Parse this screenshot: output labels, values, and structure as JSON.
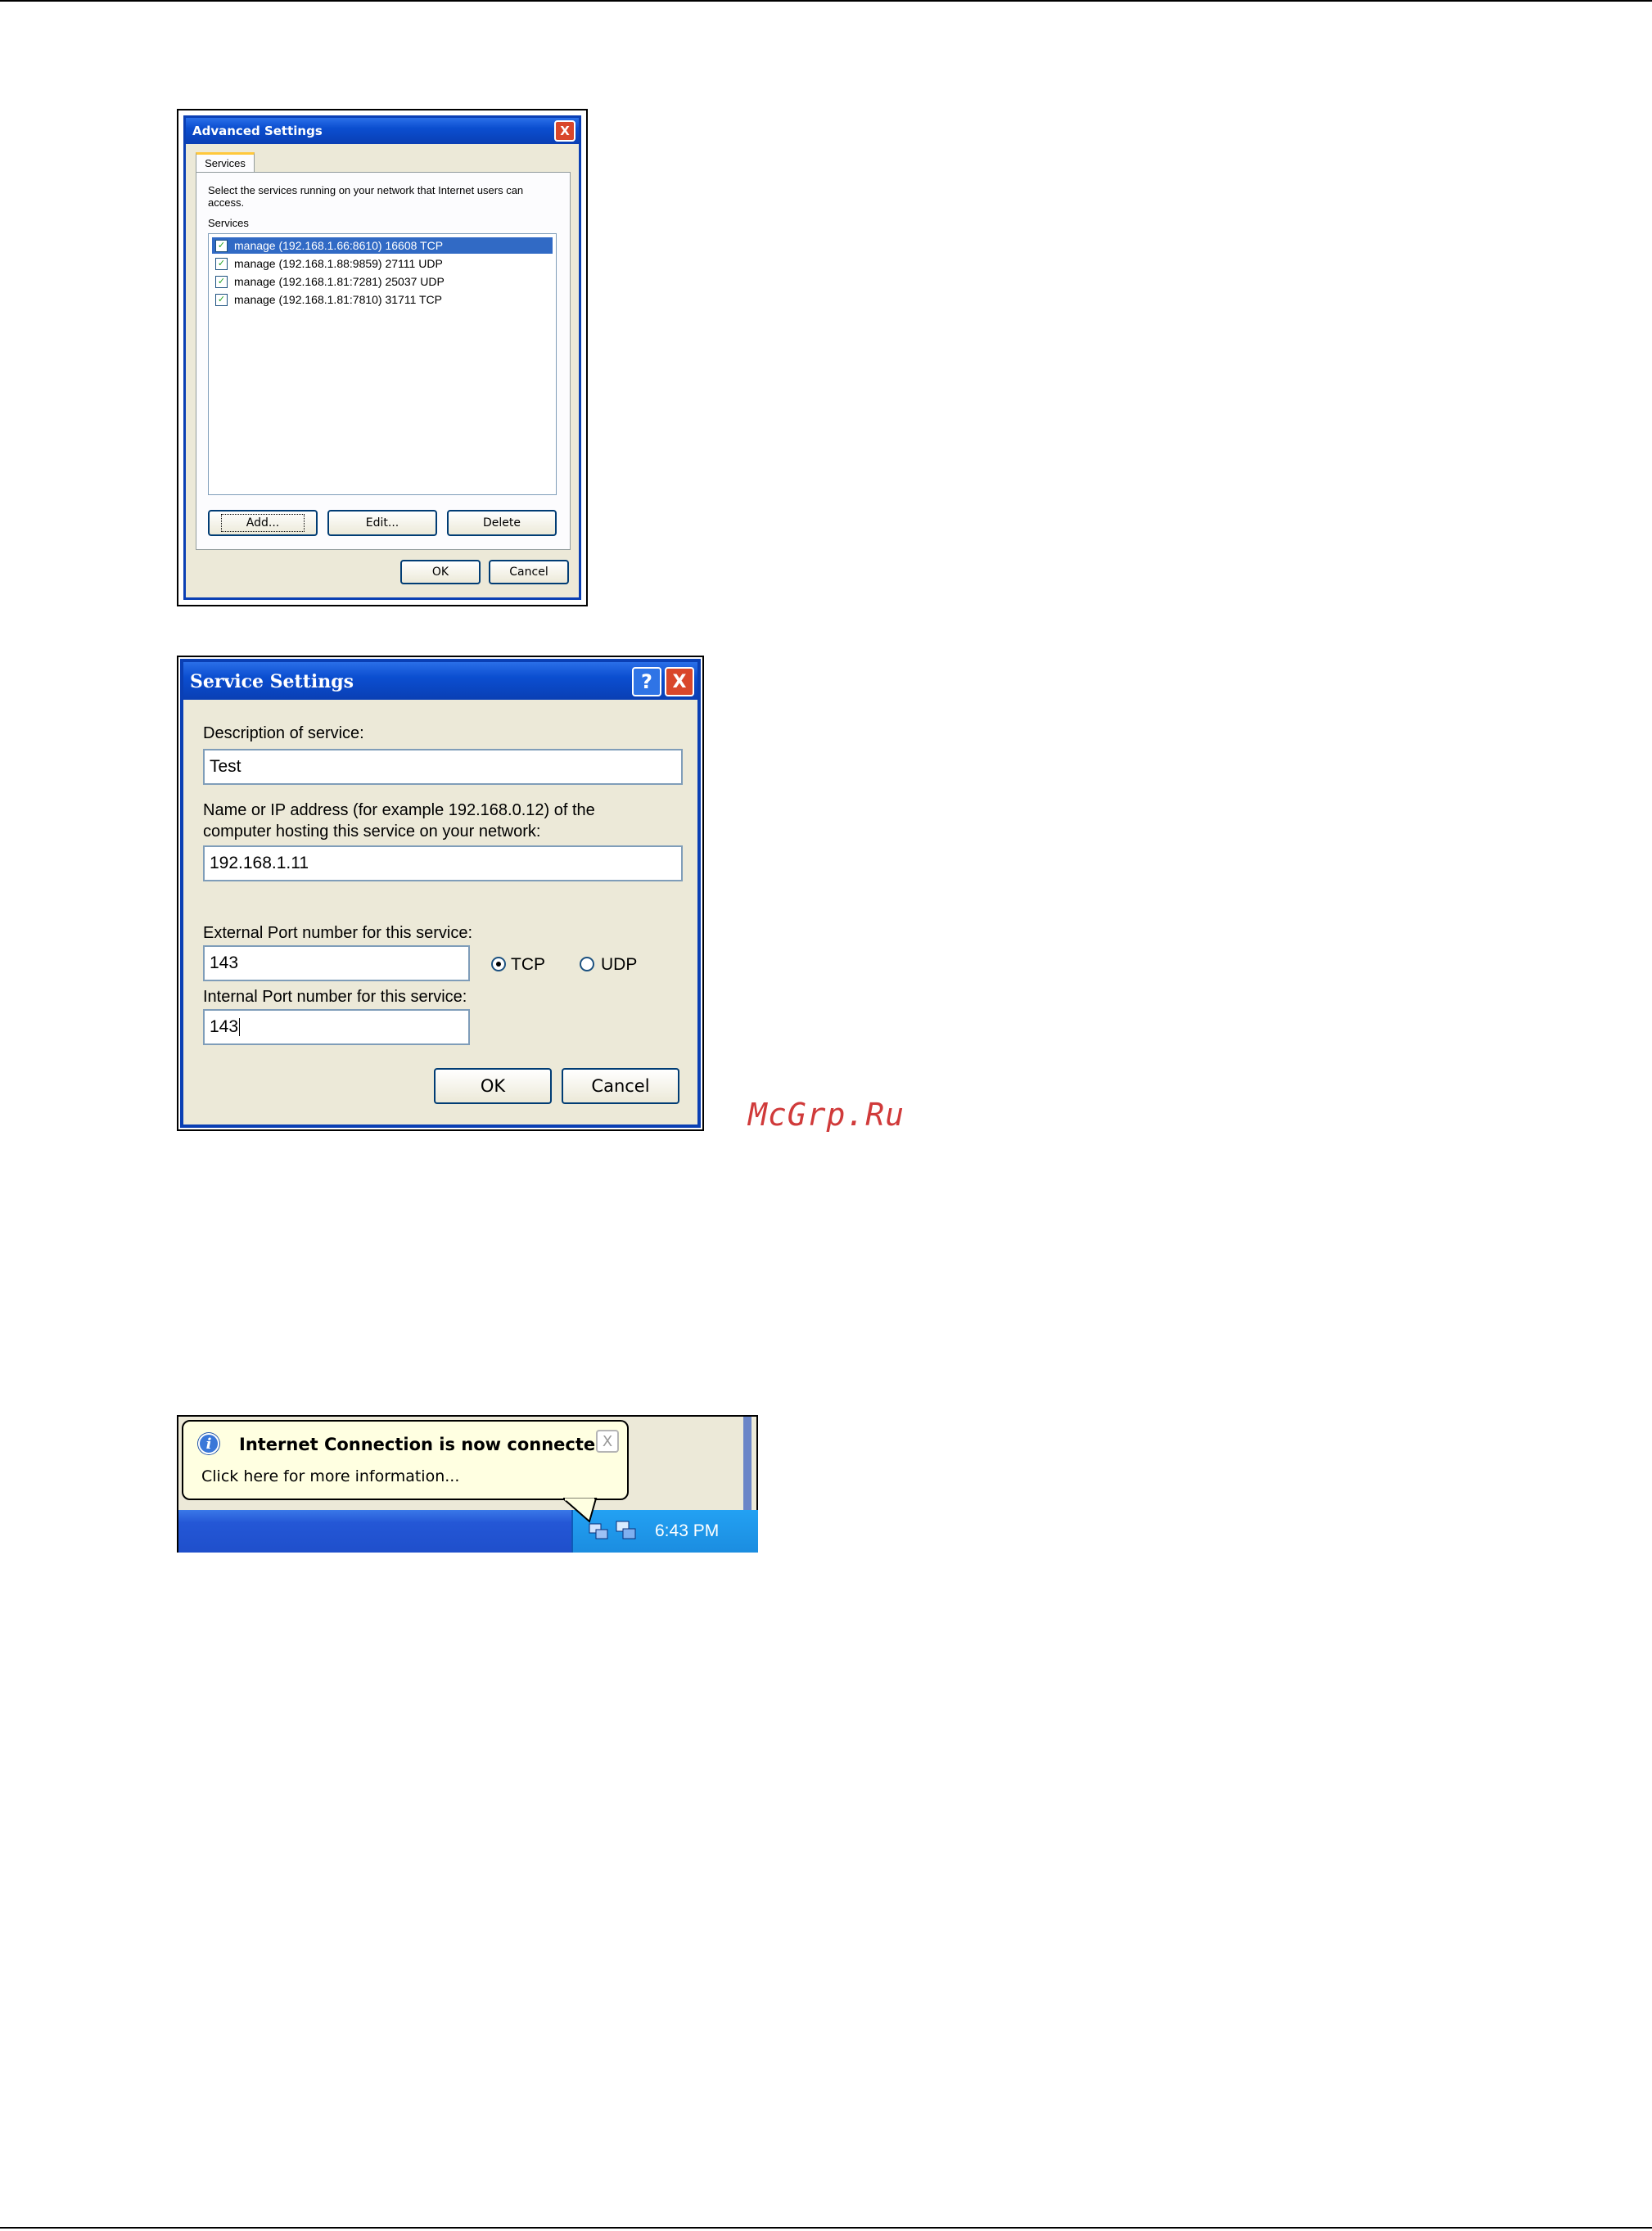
{
  "advanced": {
    "title": "Advanced Settings",
    "close_glyph": "X",
    "tab": "Services",
    "instruction": "Select the services running on your network that Internet users can access.",
    "services_label": "Services",
    "services": [
      "manage (192.168.1.66:8610) 16608 TCP",
      "manage (192.168.1.88:9859) 27111 UDP",
      "manage (192.168.1.81:7281) 25037 UDP",
      "manage (192.168.1.81:7810) 31711 TCP"
    ],
    "buttons": {
      "add": "Add...",
      "edit": "Edit...",
      "delete": "Delete",
      "ok": "OK",
      "cancel": "Cancel"
    }
  },
  "service": {
    "title": "Service Settings",
    "help_glyph": "?",
    "close_glyph": "X",
    "description_label": "Description of service:",
    "description_value": "Test",
    "host_label_line1": "Name or IP address (for example 192.168.0.12) of the",
    "host_label_line2": "computer hosting this service on your network:",
    "host_value": "192.168.1.11",
    "external_label": "External Port number for this service:",
    "external_value": "143",
    "internal_label": "Internal Port number for this service:",
    "internal_value": "143",
    "protocol_tcp": "TCP",
    "protocol_udp": "UDP",
    "selected_protocol": "TCP",
    "buttons": {
      "ok": "OK",
      "cancel": "Cancel"
    }
  },
  "watermark": "McGrp.Ru",
  "taskbar": {
    "balloon_title": "Internet Connection is now connected",
    "balloon_text": "Click here for more information...",
    "info_glyph": "i",
    "close_glyph": "X",
    "clock": "6:43 PM"
  }
}
